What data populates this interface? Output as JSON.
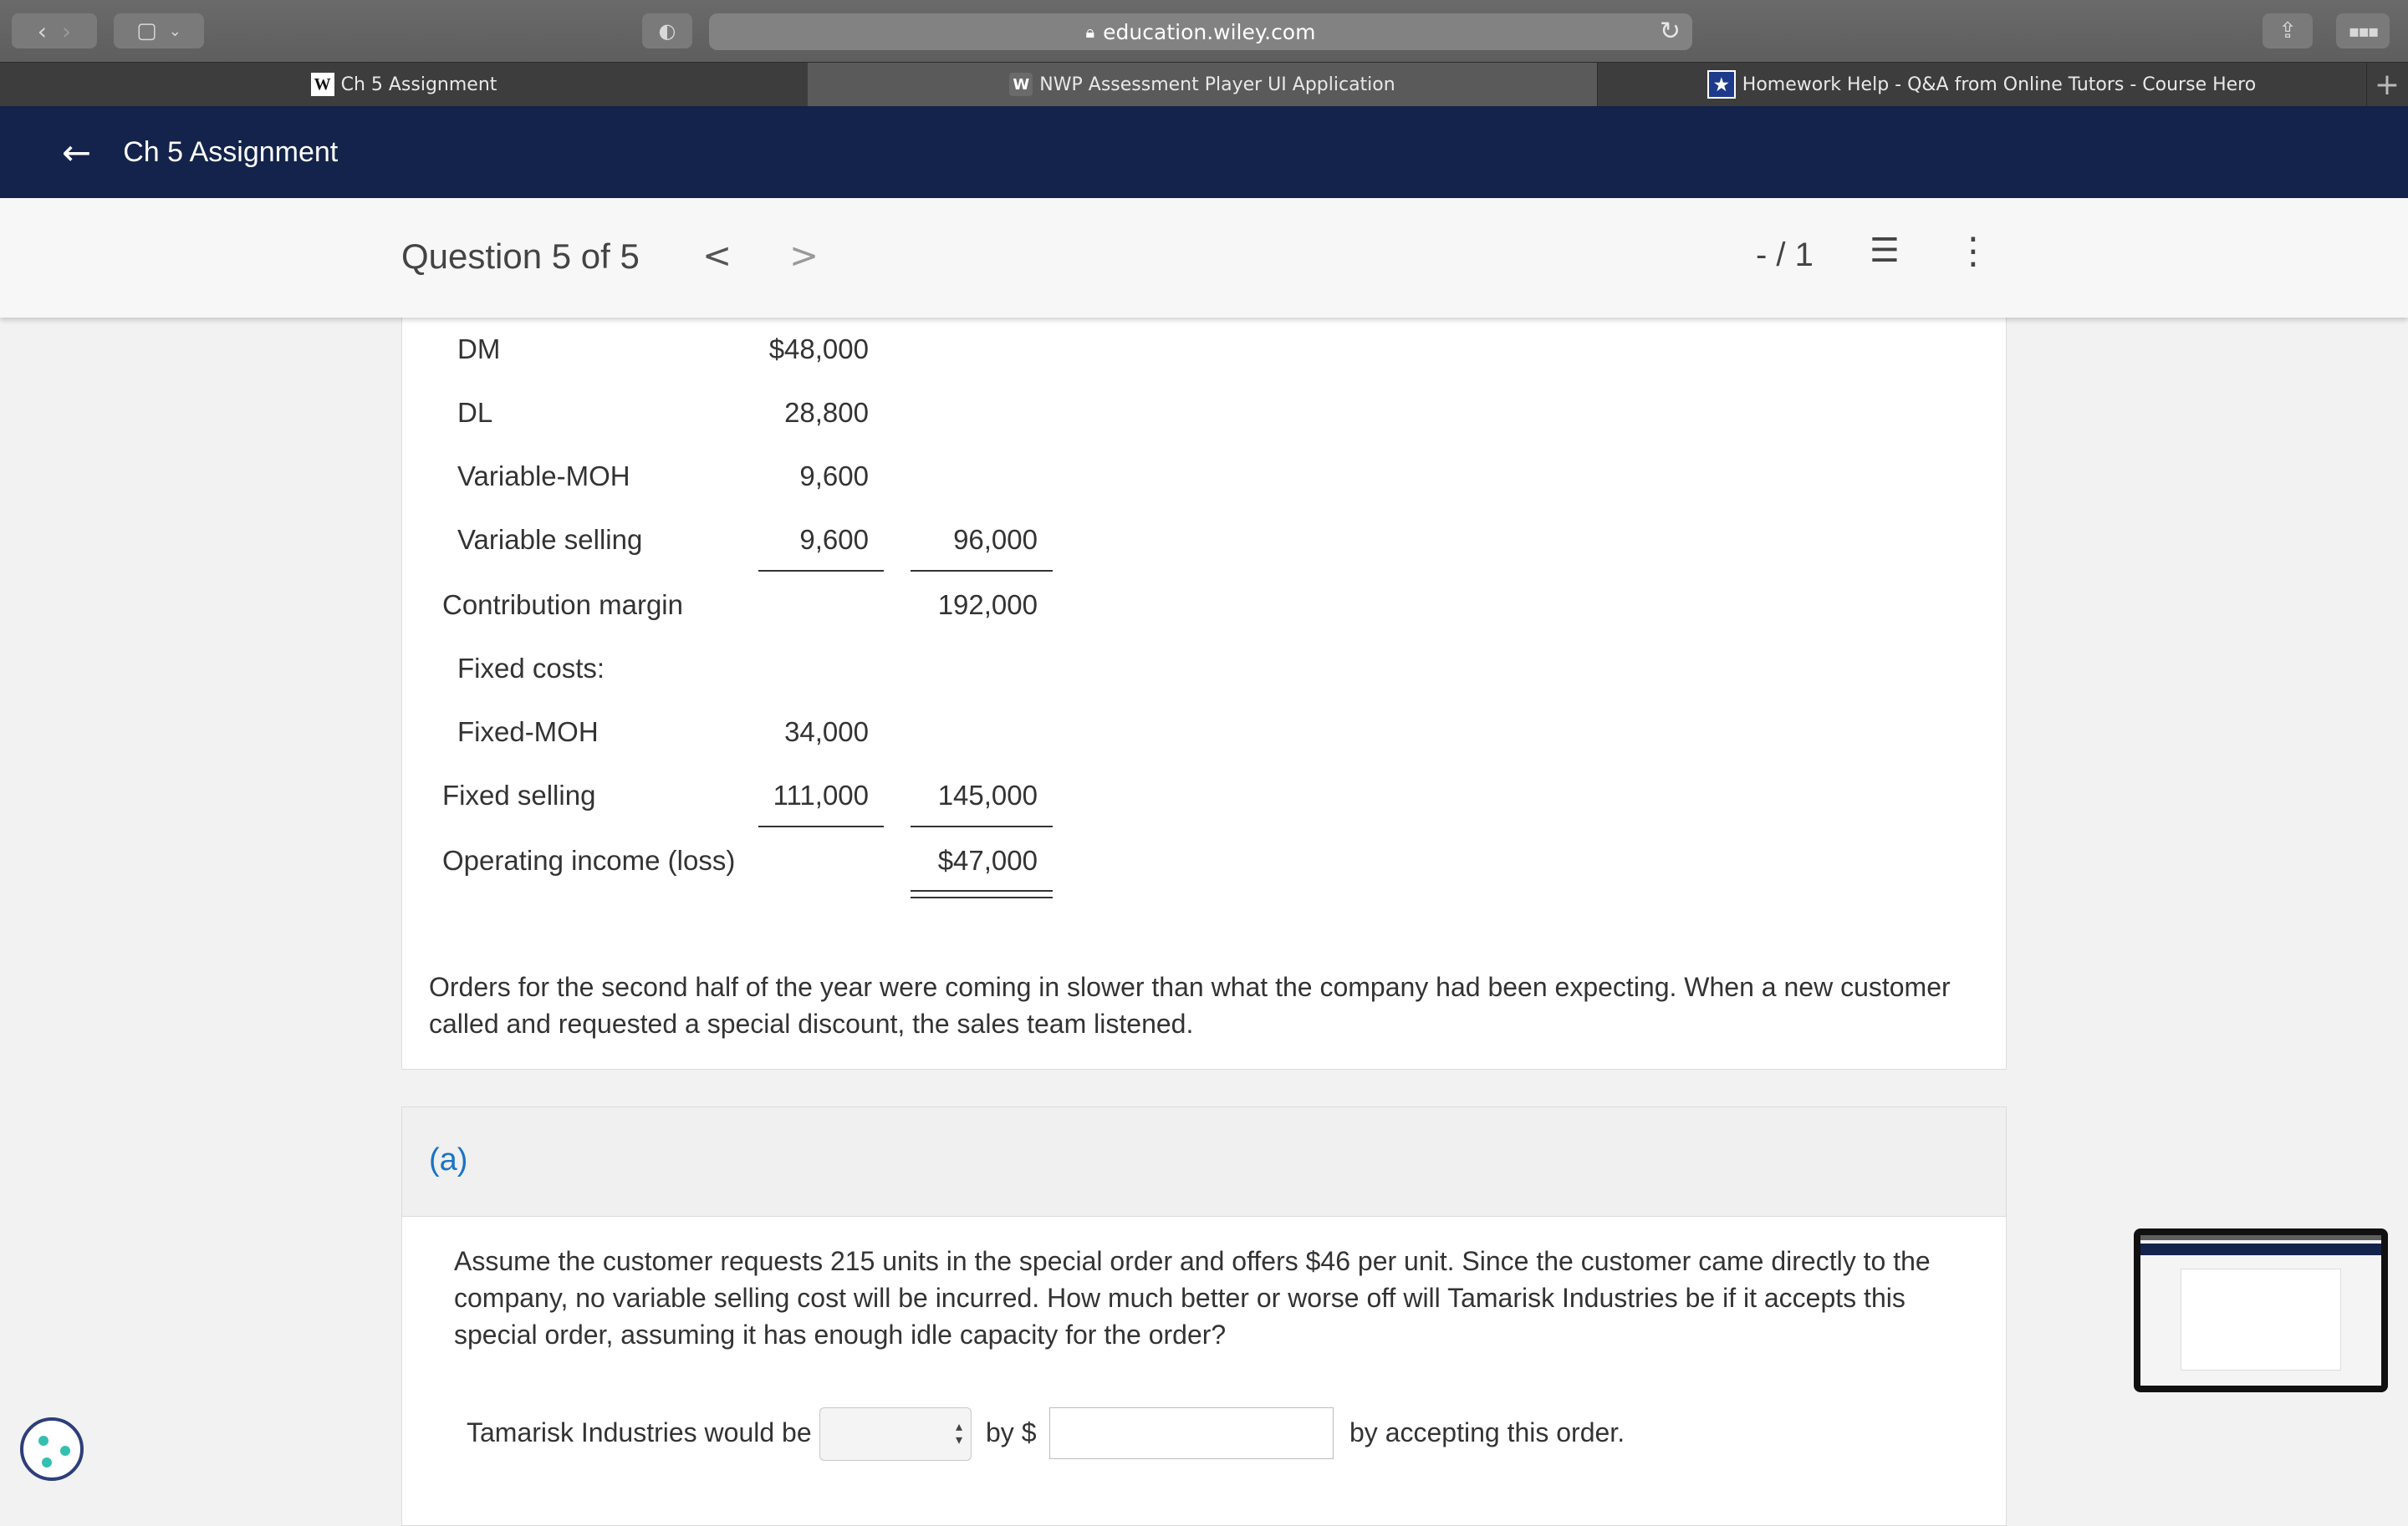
{
  "browser": {
    "url": "education.wiley.com",
    "tabs": [
      {
        "favicon": "W",
        "label": "Ch 5 Assignment"
      },
      {
        "favicon": "W",
        "label": "NWP Assessment Player UI Application"
      },
      {
        "favicon": "★",
        "label": "Homework Help - Q&A from Online Tutors - Course Hero"
      }
    ]
  },
  "header": {
    "back_icon": "←",
    "title": "Ch 5 Assignment"
  },
  "question_bar": {
    "label": "Question 5 of 5",
    "prev": "<",
    "next": ">",
    "score": "- / 1"
  },
  "statement": {
    "rows": [
      {
        "label": "DM",
        "col1": "$48,000",
        "col2": ""
      },
      {
        "label": "DL",
        "col1": "28,800",
        "col2": ""
      },
      {
        "label": "Variable-MOH",
        "col1": "9,600",
        "col2": ""
      },
      {
        "label": "Variable selling",
        "col1": "9,600",
        "col2": "96,000"
      },
      {
        "label": "Contribution margin",
        "col1": "",
        "col2": "192,000"
      },
      {
        "label": "Fixed costs:",
        "col1": "",
        "col2": ""
      },
      {
        "label": "Fixed-MOH",
        "col1": "34,000",
        "col2": ""
      },
      {
        "label": "Fixed selling",
        "col1": "111,000",
        "col2": "145,000"
      },
      {
        "label": "Operating income (loss)",
        "col1": "",
        "col2": "$47,000"
      }
    ],
    "paragraph_line1": "Orders for the second half of the year were coming in slower than what the company had been expecting. When a new customer",
    "paragraph_line2": "called and requested a special discount, the sales team listened."
  },
  "part_a": {
    "label": "(a)",
    "question_line1": "Assume the customer requests 215 units in the special order and offers $46 per unit. Since the customer came directly to the",
    "question_line2": "company, no variable selling cost will be incurred. How much better or worse off will Tamarisk Industries be if it accepts this",
    "question_line3": "special order, assuming it has enough idle capacity for the order?",
    "answer_prefix": "Tamarisk Industries would be",
    "answer_mid": "by $",
    "answer_suffix": "by accepting this order.",
    "select_value": "",
    "amount_value": ""
  },
  "colors": {
    "header_bg": "#13234b",
    "accent_blue": "#1b74c7"
  }
}
